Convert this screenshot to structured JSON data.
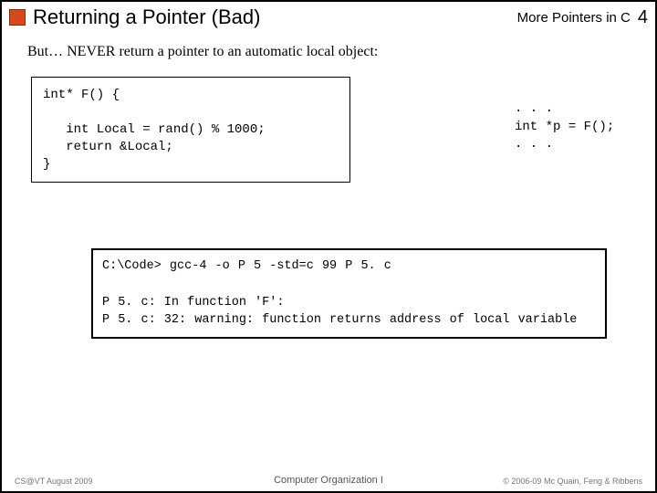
{
  "header": {
    "title": "Returning a Pointer (Bad)",
    "topic": "More Pointers in C",
    "page_number": "4"
  },
  "lead": "But… NEVER return a pointer to an automatic local object:",
  "code_left": "int* F() {\n\n   int Local = rand() % 1000;\n   return &Local;\n}",
  "caller_code": ". . .\nint *p = F();\n. . .",
  "compile_output": "C:\\Code> gcc-4 -o P 5 -std=c 99 P 5. c\n\nP 5. c: In function 'F':\nP 5. c: 32: warning: function returns address of local variable",
  "footer": {
    "left": "CS@VT August 2009",
    "center": "Computer Organization I",
    "right": "© 2006-09  Mc Quain, Feng & Ribbens"
  }
}
